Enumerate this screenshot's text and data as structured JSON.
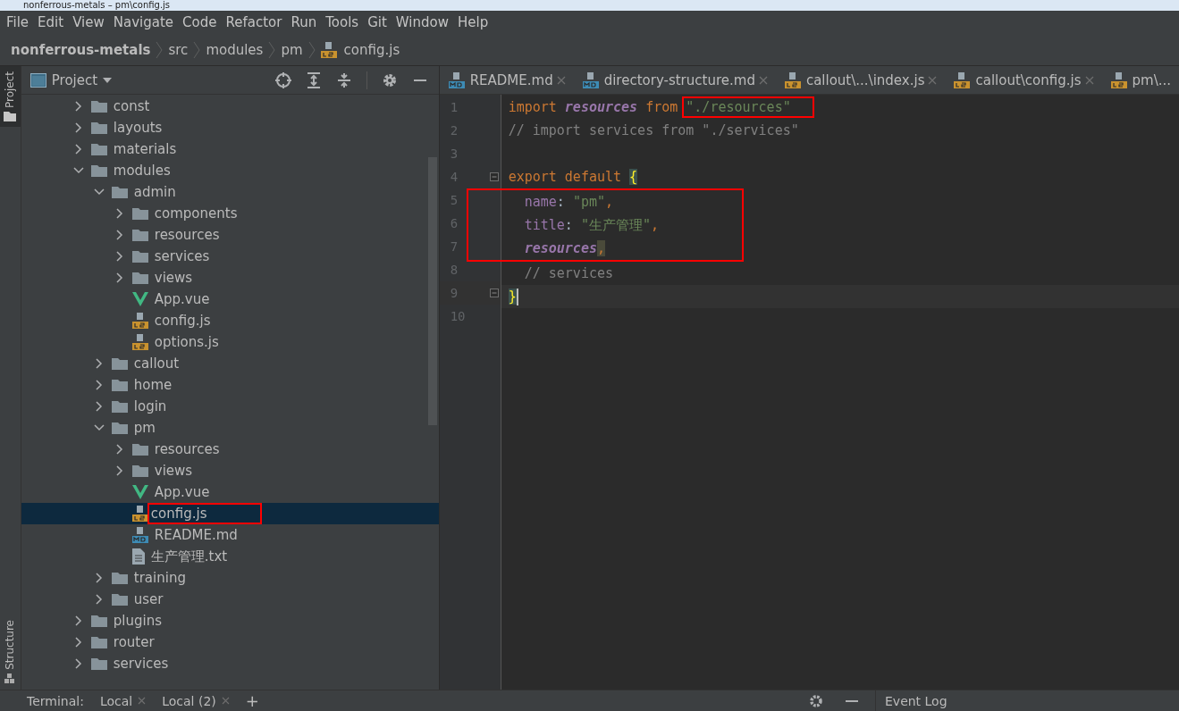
{
  "window": {
    "title": "nonferrous-metals – pm\\config.js"
  },
  "menu": [
    "File",
    "Edit",
    "View",
    "Navigate",
    "Code",
    "Refactor",
    "Run",
    "Tools",
    "Git",
    "Window",
    "Help"
  ],
  "breadcrumb": [
    {
      "label": "nonferrous-metals",
      "kind": "project"
    },
    {
      "label": "src",
      "kind": "folder"
    },
    {
      "label": "modules",
      "kind": "folder"
    },
    {
      "label": "pm",
      "kind": "folder"
    },
    {
      "label": "config.js",
      "kind": "js"
    }
  ],
  "side_stripe": {
    "top": "Project",
    "bottom": "Structure"
  },
  "project_panel": {
    "title": "Project",
    "tree": [
      {
        "label": "const",
        "kind": "folder",
        "expanded": false,
        "selected": false
      },
      {
        "label": "layouts",
        "kind": "folder",
        "expanded": false,
        "selected": false
      },
      {
        "label": "materials",
        "kind": "folder",
        "expanded": false,
        "selected": false
      },
      {
        "label": "modules",
        "kind": "folder",
        "expanded": true,
        "selected": false,
        "children": [
          {
            "label": "admin",
            "kind": "folder",
            "expanded": true,
            "selected": false,
            "children": [
              {
                "label": "components",
                "kind": "folder",
                "expanded": false,
                "selected": false
              },
              {
                "label": "resources",
                "kind": "folder",
                "expanded": false,
                "selected": false
              },
              {
                "label": "services",
                "kind": "folder",
                "expanded": false,
                "selected": false
              },
              {
                "label": "views",
                "kind": "folder",
                "expanded": false,
                "selected": false
              },
              {
                "label": "App.vue",
                "kind": "vue",
                "selected": false
              },
              {
                "label": "config.js",
                "kind": "js",
                "selected": false
              },
              {
                "label": "options.js",
                "kind": "js",
                "selected": false
              }
            ]
          },
          {
            "label": "callout",
            "kind": "folder",
            "expanded": false,
            "selected": false
          },
          {
            "label": "home",
            "kind": "folder",
            "expanded": false,
            "selected": false
          },
          {
            "label": "login",
            "kind": "folder",
            "expanded": false,
            "selected": false
          },
          {
            "label": "pm",
            "kind": "folder",
            "expanded": true,
            "selected": false,
            "children": [
              {
                "label": "resources",
                "kind": "folder",
                "expanded": false,
                "selected": false
              },
              {
                "label": "views",
                "kind": "folder",
                "expanded": false,
                "selected": false
              },
              {
                "label": "App.vue",
                "kind": "vue",
                "selected": false
              },
              {
                "label": "config.js",
                "kind": "js",
                "selected": true,
                "boxed": true
              },
              {
                "label": "README.md",
                "kind": "md",
                "selected": false
              },
              {
                "label": "生产管理.txt",
                "kind": "txt",
                "selected": false
              }
            ]
          },
          {
            "label": "training",
            "kind": "folder",
            "expanded": false,
            "selected": false
          },
          {
            "label": "user",
            "kind": "folder",
            "expanded": false,
            "selected": false
          }
        ]
      },
      {
        "label": "plugins",
        "kind": "folder",
        "expanded": false,
        "selected": false
      },
      {
        "label": "router",
        "kind": "folder",
        "expanded": false,
        "selected": false
      },
      {
        "label": "services",
        "kind": "folder",
        "expanded": false,
        "selected": false
      }
    ]
  },
  "tabs": [
    {
      "label": "README.md",
      "kind": "md"
    },
    {
      "label": "directory-structure.md",
      "kind": "md"
    },
    {
      "label": "callout\\...\\index.js",
      "kind": "js"
    },
    {
      "label": "callout\\config.js",
      "kind": "js"
    },
    {
      "label": "pm\\...",
      "kind": "js"
    }
  ],
  "editor": {
    "lines": [
      {
        "number": "1",
        "tokens": [
          {
            "text": "import ",
            "kind": "kw"
          },
          {
            "text": "resources",
            "kind": "ident"
          },
          {
            "text": " from ",
            "kind": "kw"
          },
          {
            "text": "\"./resources\"",
            "kind": "str",
            "boxed": true
          }
        ]
      },
      {
        "number": "2",
        "tokens": [
          {
            "text": "// import services from \"./services\"",
            "kind": "comment"
          }
        ]
      },
      {
        "number": "3"
      },
      {
        "number": "4",
        "fold": true,
        "tokens": [
          {
            "text": "export default ",
            "kind": "kw"
          },
          {
            "text": "{",
            "kind": "brace"
          }
        ]
      },
      {
        "number": "5",
        "boxed": true,
        "tokens": [
          {
            "text": "  name",
            "kind": "prop"
          },
          {
            "text": ": "
          },
          {
            "text": "\"pm\"",
            "kind": "str"
          },
          {
            "text": ",",
            "kind": "kw"
          }
        ]
      },
      {
        "number": "6",
        "boxed": true,
        "tokens": [
          {
            "text": "  title",
            "kind": "prop"
          },
          {
            "text": ": "
          },
          {
            "text": "\"生产管理\"",
            "kind": "str"
          },
          {
            "text": ",",
            "kind": "kw"
          }
        ]
      },
      {
        "number": "7",
        "boxed": true,
        "tokens": [
          {
            "text": "  resources",
            "kind": "ident"
          },
          {
            "text": ",",
            "kind": "match"
          }
        ]
      },
      {
        "number": "8",
        "tokens": [
          {
            "text": "  // services",
            "kind": "comment"
          }
        ]
      },
      {
        "number": "9",
        "fold": true,
        "current": true,
        "tokens": [
          {
            "text": "}",
            "kind": "brace"
          }
        ]
      },
      {
        "number": "10"
      }
    ]
  },
  "bottom_bar": {
    "label": "Terminal:",
    "tabs": [
      {
        "label": "Local"
      },
      {
        "label": "Local (2)"
      }
    ],
    "add": "+",
    "right": "Event Log"
  }
}
